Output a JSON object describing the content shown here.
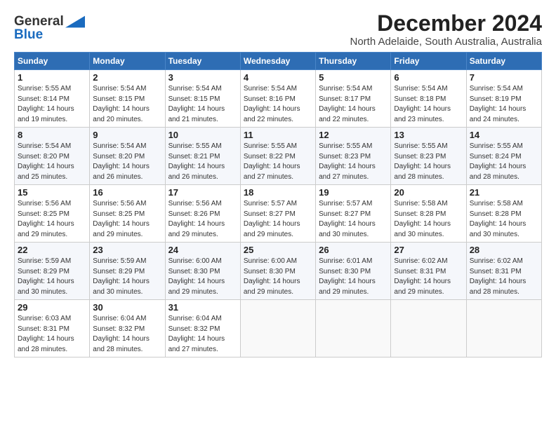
{
  "header": {
    "logo_general": "General",
    "logo_blue": "Blue",
    "main_title": "December 2024",
    "subtitle": "North Adelaide, South Australia, Australia"
  },
  "calendar": {
    "days_of_week": [
      "Sunday",
      "Monday",
      "Tuesday",
      "Wednesday",
      "Thursday",
      "Friday",
      "Saturday"
    ],
    "weeks": [
      [
        null,
        {
          "day": "2",
          "line1": "Sunrise: 5:54 AM",
          "line2": "Sunset: 8:15 PM",
          "line3": "Daylight: 14 hours",
          "line4": "and 20 minutes."
        },
        {
          "day": "3",
          "line1": "Sunrise: 5:54 AM",
          "line2": "Sunset: 8:15 PM",
          "line3": "Daylight: 14 hours",
          "line4": "and 21 minutes."
        },
        {
          "day": "4",
          "line1": "Sunrise: 5:54 AM",
          "line2": "Sunset: 8:16 PM",
          "line3": "Daylight: 14 hours",
          "line4": "and 22 minutes."
        },
        {
          "day": "5",
          "line1": "Sunrise: 5:54 AM",
          "line2": "Sunset: 8:17 PM",
          "line3": "Daylight: 14 hours",
          "line4": "and 22 minutes."
        },
        {
          "day": "6",
          "line1": "Sunrise: 5:54 AM",
          "line2": "Sunset: 8:18 PM",
          "line3": "Daylight: 14 hours",
          "line4": "and 23 minutes."
        },
        {
          "day": "7",
          "line1": "Sunrise: 5:54 AM",
          "line2": "Sunset: 8:19 PM",
          "line3": "Daylight: 14 hours",
          "line4": "and 24 minutes."
        }
      ],
      [
        {
          "day": "1",
          "line1": "Sunrise: 5:55 AM",
          "line2": "Sunset: 8:14 PM",
          "line3": "Daylight: 14 hours",
          "line4": "and 19 minutes."
        },
        {
          "day": "9",
          "line1": "Sunrise: 5:54 AM",
          "line2": "Sunset: 8:20 PM",
          "line3": "Daylight: 14 hours",
          "line4": "and 26 minutes."
        },
        {
          "day": "10",
          "line1": "Sunrise: 5:55 AM",
          "line2": "Sunset: 8:21 PM",
          "line3": "Daylight: 14 hours",
          "line4": "and 26 minutes."
        },
        {
          "day": "11",
          "line1": "Sunrise: 5:55 AM",
          "line2": "Sunset: 8:22 PM",
          "line3": "Daylight: 14 hours",
          "line4": "and 27 minutes."
        },
        {
          "day": "12",
          "line1": "Sunrise: 5:55 AM",
          "line2": "Sunset: 8:23 PM",
          "line3": "Daylight: 14 hours",
          "line4": "and 27 minutes."
        },
        {
          "day": "13",
          "line1": "Sunrise: 5:55 AM",
          "line2": "Sunset: 8:23 PM",
          "line3": "Daylight: 14 hours",
          "line4": "and 28 minutes."
        },
        {
          "day": "14",
          "line1": "Sunrise: 5:55 AM",
          "line2": "Sunset: 8:24 PM",
          "line3": "Daylight: 14 hours",
          "line4": "and 28 minutes."
        }
      ],
      [
        {
          "day": "8",
          "line1": "Sunrise: 5:54 AM",
          "line2": "Sunset: 8:20 PM",
          "line3": "Daylight: 14 hours",
          "line4": "and 25 minutes."
        },
        {
          "day": "16",
          "line1": "Sunrise: 5:56 AM",
          "line2": "Sunset: 8:25 PM",
          "line3": "Daylight: 14 hours",
          "line4": "and 29 minutes."
        },
        {
          "day": "17",
          "line1": "Sunrise: 5:56 AM",
          "line2": "Sunset: 8:26 PM",
          "line3": "Daylight: 14 hours",
          "line4": "and 29 minutes."
        },
        {
          "day": "18",
          "line1": "Sunrise: 5:57 AM",
          "line2": "Sunset: 8:27 PM",
          "line3": "Daylight: 14 hours",
          "line4": "and 29 minutes."
        },
        {
          "day": "19",
          "line1": "Sunrise: 5:57 AM",
          "line2": "Sunset: 8:27 PM",
          "line3": "Daylight: 14 hours",
          "line4": "and 30 minutes."
        },
        {
          "day": "20",
          "line1": "Sunrise: 5:58 AM",
          "line2": "Sunset: 8:28 PM",
          "line3": "Daylight: 14 hours",
          "line4": "and 30 minutes."
        },
        {
          "day": "21",
          "line1": "Sunrise: 5:58 AM",
          "line2": "Sunset: 8:28 PM",
          "line3": "Daylight: 14 hours",
          "line4": "and 30 minutes."
        }
      ],
      [
        {
          "day": "15",
          "line1": "Sunrise: 5:56 AM",
          "line2": "Sunset: 8:25 PM",
          "line3": "Daylight: 14 hours",
          "line4": "and 29 minutes."
        },
        {
          "day": "23",
          "line1": "Sunrise: 5:59 AM",
          "line2": "Sunset: 8:29 PM",
          "line3": "Daylight: 14 hours",
          "line4": "and 30 minutes."
        },
        {
          "day": "24",
          "line1": "Sunrise: 6:00 AM",
          "line2": "Sunset: 8:30 PM",
          "line3": "Daylight: 14 hours",
          "line4": "and 29 minutes."
        },
        {
          "day": "25",
          "line1": "Sunrise: 6:00 AM",
          "line2": "Sunset: 8:30 PM",
          "line3": "Daylight: 14 hours",
          "line4": "and 29 minutes."
        },
        {
          "day": "26",
          "line1": "Sunrise: 6:01 AM",
          "line2": "Sunset: 8:30 PM",
          "line3": "Daylight: 14 hours",
          "line4": "and 29 minutes."
        },
        {
          "day": "27",
          "line1": "Sunrise: 6:02 AM",
          "line2": "Sunset: 8:31 PM",
          "line3": "Daylight: 14 hours",
          "line4": "and 29 minutes."
        },
        {
          "day": "28",
          "line1": "Sunrise: 6:02 AM",
          "line2": "Sunset: 8:31 PM",
          "line3": "Daylight: 14 hours",
          "line4": "and 28 minutes."
        }
      ],
      [
        {
          "day": "22",
          "line1": "Sunrise: 5:59 AM",
          "line2": "Sunset: 8:29 PM",
          "line3": "Daylight: 14 hours",
          "line4": "and 30 minutes."
        },
        {
          "day": "30",
          "line1": "Sunrise: 6:04 AM",
          "line2": "Sunset: 8:32 PM",
          "line3": "Daylight: 14 hours",
          "line4": "and 28 minutes."
        },
        {
          "day": "31",
          "line1": "Sunrise: 6:04 AM",
          "line2": "Sunset: 8:32 PM",
          "line3": "Daylight: 14 hours",
          "line4": "and 27 minutes."
        },
        null,
        null,
        null,
        null
      ],
      [
        {
          "day": "29",
          "line1": "Sunrise: 6:03 AM",
          "line2": "Sunset: 8:31 PM",
          "line3": "Daylight: 14 hours",
          "line4": "and 28 minutes."
        },
        null,
        null,
        null,
        null,
        null,
        null
      ]
    ]
  }
}
